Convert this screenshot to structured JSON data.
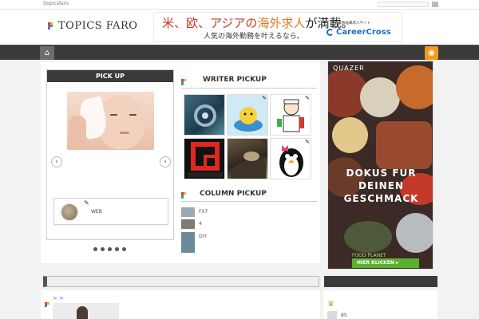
{
  "topbar": {
    "site_name": "|topicsfaro"
  },
  "header": {
    "logo_text": "TOPICS FARO"
  },
  "banner": {
    "line1_a": "米、欧、アジアの",
    "line1_b": "海外求人",
    "line1_c": "が満載。",
    "line2": "人気の海外勤務を叶えるなら。",
    "sub": "外資系転職求人サイト",
    "brand": "CareerCross"
  },
  "nav": {
    "home_icon": "home-icon",
    "rss_icon": "rss-icon"
  },
  "pickup": {
    "title": "PICK UP",
    "writer_name": "WEB",
    "dots": 5
  },
  "writer_pickup": {
    "title": "WRITER PICKUP"
  },
  "column_pickup": {
    "title": "COLUMN PICKUP",
    "items": [
      "FX7",
      "4",
      "DIY"
    ]
  },
  "ad": {
    "brand": "QUAZER",
    "line1": "DOKUS FUR",
    "line2": "DEINEN",
    "line3": "GESCHMACK",
    "sub": "FOOD PLANET",
    "cta": "HIER KLICKEN ▸"
  },
  "lower": {
    "breadcrumb": "> >",
    "rank_num": "85"
  },
  "colors": {
    "nav_bg": "#3a3a3a",
    "rss": "#f39a1c",
    "cta": "#5bb12f"
  }
}
